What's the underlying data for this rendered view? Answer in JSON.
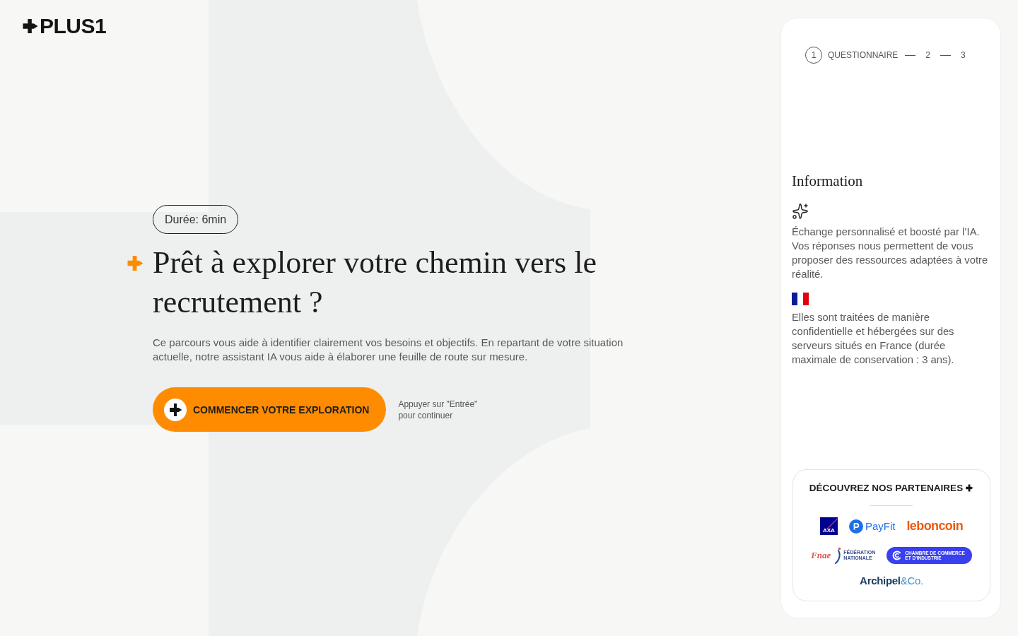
{
  "logo": {
    "text": "PLUS1"
  },
  "hero": {
    "duration_badge": "Durée: 6min",
    "title": "Prêt à explorer votre chemin vers le recrutement ?",
    "description": "Ce parcours vous aide à identifier clairement vos besoins et objectifs. En repartant de votre situation actuelle, notre assistant IA vous aide à élaborer une feuille de route sur mesure.",
    "cta_button": "COMMENCER VOTRE EXPLORATION",
    "hint": [
      "Appuyer sur \"Entrée\"",
      "pour continuer"
    ]
  },
  "side_panel": {
    "steps": [
      {
        "number": "1",
        "label": "QUESTIONNAIRE",
        "selected": true
      },
      {
        "number": "2",
        "selected": false
      },
      {
        "number": "3",
        "selected": false
      }
    ],
    "information": {
      "title": "Information",
      "items": [
        {
          "kind": "sparkle",
          "text": "Échange personnalisé et boosté par l’IA. Vos réponses nous permettent de vous proposer des ressources adaptées à votre réalité."
        },
        {
          "kind": "flag",
          "text": "Elles sont traitées de manière confidentielle et hébergées sur des serveurs situés en France (durée maximale de conservation : 3 ans)."
        }
      ]
    },
    "partners": {
      "title": "DÉCOUVREZ NOS PARTENAIRES",
      "logos": [
        {
          "kind": "axa",
          "name": "AXA"
        },
        {
          "kind": "payfit",
          "name": "PayFit"
        },
        {
          "kind": "leboncoin",
          "name": "leboncoin"
        },
        {
          "kind": "fnae",
          "name": "Fnae",
          "caption": [
            "FÉDÉRATION",
            "NATIONALE"
          ]
        },
        {
          "kind": "cci",
          "lines": [
            "CHAMBRE DE COMMERCE",
            "ET D'INDUSTRIE"
          ]
        },
        {
          "kind": "archipel",
          "name": "Archipel",
          "suffix": "&Co."
        }
      ]
    }
  }
}
